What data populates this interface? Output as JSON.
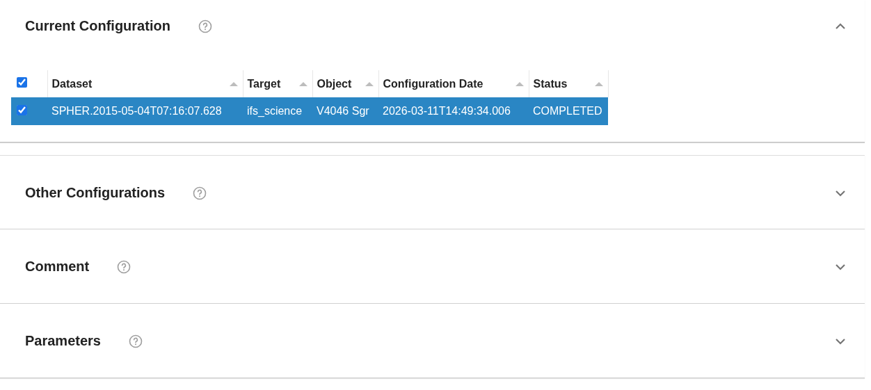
{
  "sections": [
    {
      "title": "Current Configuration",
      "expanded": true,
      "table": {
        "all_checked": true,
        "columns": [
          "Dataset",
          "Target",
          "Object",
          "Configuration Date",
          "Status"
        ],
        "rows": [
          {
            "selected": true,
            "checked": true,
            "cells": [
              "SPHER.2015-05-04T07:16:07.628",
              "ifs_science",
              "V4046 Sgr",
              "2026-03-11T14:49:34.006",
              "COMPLETED"
            ]
          }
        ]
      }
    },
    {
      "title": "Other Configurations",
      "expanded": false
    },
    {
      "title": "Comment",
      "expanded": false
    },
    {
      "title": "Parameters",
      "expanded": false
    }
  ]
}
